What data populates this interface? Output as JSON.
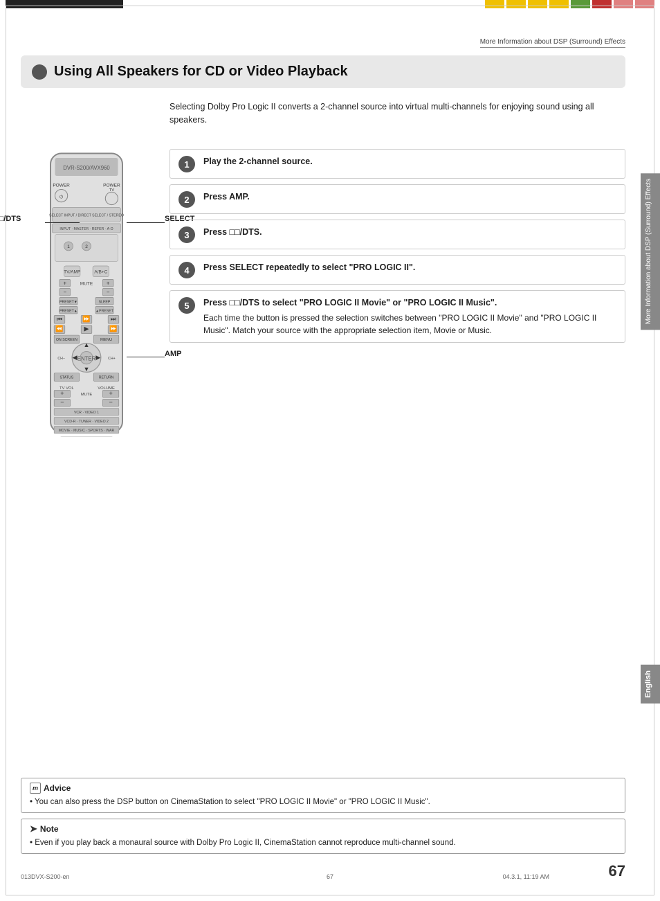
{
  "page": {
    "number": "67",
    "header_text": "More Information about DSP (Surround) Effects",
    "footer_left": "013DVX-S200-en",
    "footer_center": "67",
    "footer_right": "04.3.1, 11:19 AM"
  },
  "title": {
    "text": "Using All Speakers for CD or Video Playback"
  },
  "intro": {
    "text": "Selecting Dolby Pro Logic II converts a 2-channel source into virtual multi-channels for enjoying sound using all speakers."
  },
  "labels": {
    "dts": "□□/DTS",
    "select": "SELECT",
    "amp": "AMP"
  },
  "steps": [
    {
      "num": "1",
      "main": "Play the 2-channel source.",
      "sub": ""
    },
    {
      "num": "2",
      "main": "Press AMP.",
      "sub": ""
    },
    {
      "num": "3",
      "main": "Press □□/DTS.",
      "sub": ""
    },
    {
      "num": "4",
      "main": "Press SELECT repeatedly to select \"PRO LOGIC II\".",
      "sub": ""
    },
    {
      "num": "5",
      "main": "Press □□/DTS to select \"PRO LOGIC II Movie\" or \"PRO LOGIC II Music\".",
      "sub": "Each time the button is pressed the selection switches between \"PRO LOGIC II Movie\" and \"PRO LOGIC II Music\". Match your source with the appropriate selection item, Movie or Music."
    }
  ],
  "advice": {
    "header": "Advice",
    "icon": "m",
    "text": "• You can also press the DSP button on CinemaStation to select \"PRO LOGIC II Movie\" or \"PRO LOGIC II Music\"."
  },
  "note": {
    "header": "Note",
    "text": "• Even if you play back a monaural source with Dolby Pro Logic II, CinemaStation cannot reproduce multi-channel sound."
  },
  "side_tab": {
    "text": "More Information about DSP (Surround) Effects"
  },
  "side_tab_english": {
    "text": "English"
  }
}
